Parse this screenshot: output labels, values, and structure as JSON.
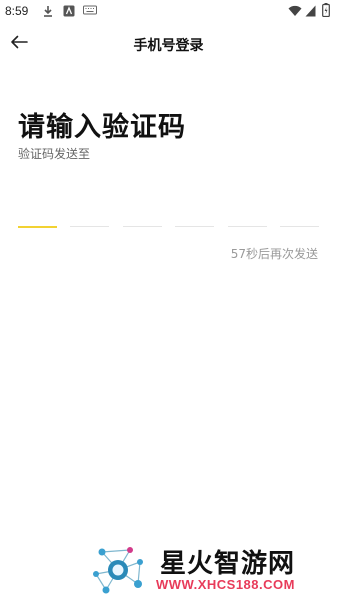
{
  "status_bar": {
    "time": "8:59",
    "icons": [
      "download-icon",
      "notification-app-icon",
      "keyboard-icon",
      "wifi-icon",
      "signal-icon",
      "battery-icon"
    ]
  },
  "header": {
    "back_icon": "arrow-left-icon",
    "title": "手机号登录"
  },
  "main": {
    "title": "请输入验证码",
    "subtitle": "验证码发送至",
    "code_slots": 6,
    "active_slot_color": "#f2d232",
    "resend_text": "57秒后再次发送"
  },
  "watermark": {
    "name": "星火智游网",
    "url": "WWW.XHCS188.COM"
  }
}
